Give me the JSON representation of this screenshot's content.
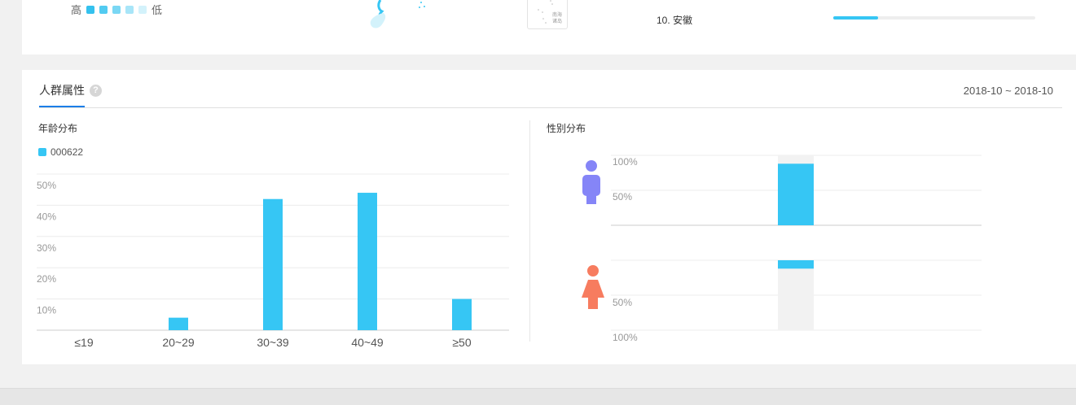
{
  "top": {
    "legend": {
      "high": "高",
      "low": "低",
      "swatches": [
        "#34c1ee",
        "#52cbf1",
        "#7ad7f4",
        "#a8e5f8",
        "#d3f2fb"
      ]
    },
    "inset_label": "南海诸岛",
    "rank_item": {
      "label": "10. 安徽",
      "fraction": 0.22,
      "color": "#36c6f4"
    }
  },
  "section": {
    "tab_label": "人群属性",
    "help_icon": "question-icon",
    "date_range": "2018-10 ~ 2018-10"
  },
  "age": {
    "title": "年龄分布",
    "legend_label": "000622"
  },
  "gender": {
    "title": "性别分布",
    "male_icon": "male-icon",
    "female_icon": "female-icon",
    "male_color": "#8585f7",
    "female_color": "#f77c5f"
  },
  "chart_data": [
    {
      "type": "bar",
      "title": "年龄分布",
      "categories": [
        "≤19",
        "20~29",
        "30~39",
        "40~49",
        "≥50"
      ],
      "series": [
        {
          "name": "000622",
          "values": [
            0,
            4,
            42,
            44,
            10
          ],
          "color": "#36c6f4"
        }
      ],
      "ylim": [
        0,
        50
      ],
      "yticks": [
        "10%",
        "20%",
        "30%",
        "40%",
        "50%"
      ],
      "grid": true
    },
    {
      "type": "bar",
      "title": "性别分布",
      "categories": [
        "男",
        "女"
      ],
      "values": [
        88,
        12
      ],
      "unit": "%",
      "male_axis_labels": [
        "100%",
        "50%"
      ],
      "female_axis_labels": [
        "50%",
        "100%"
      ],
      "color": "#36c6f4",
      "grid": true
    }
  ]
}
